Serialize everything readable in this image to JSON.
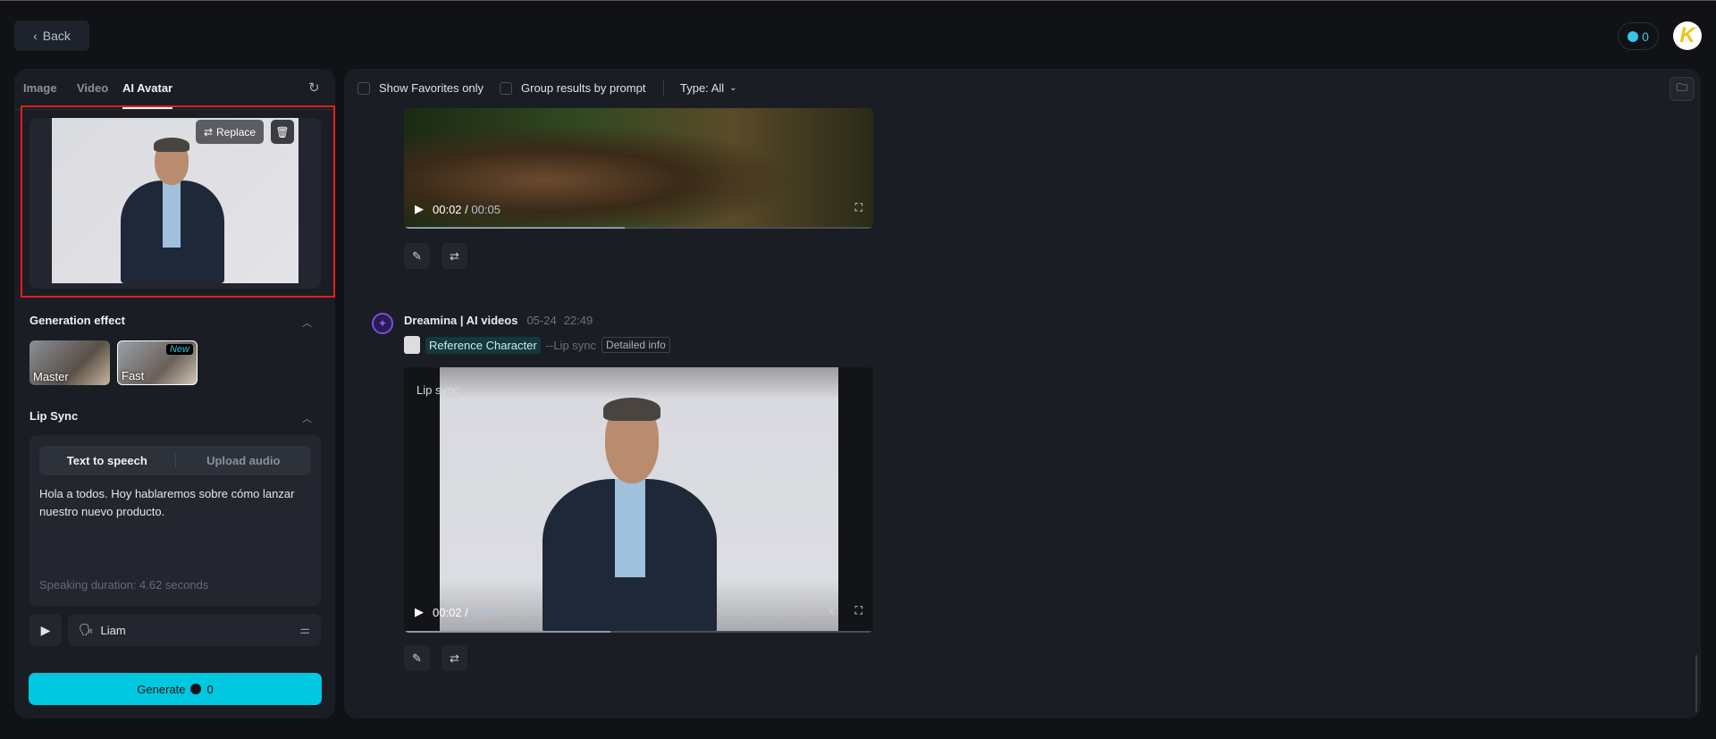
{
  "header": {
    "back_label": "Back",
    "credits": "0",
    "user_initial": "K"
  },
  "left_panel": {
    "tabs": [
      {
        "label": "Image"
      },
      {
        "label": "Video"
      },
      {
        "label": "AI Avatar",
        "active": true
      }
    ],
    "image_card": {
      "replace_label": "Replace"
    },
    "generation_effect": {
      "title": "Generation effect",
      "options": [
        {
          "label": "Master"
        },
        {
          "label": "Fast",
          "badge": "New",
          "selected": true
        }
      ]
    },
    "lip_sync": {
      "title": "Lip Sync",
      "modes": [
        {
          "label": "Text to speech",
          "active": true
        },
        {
          "label": "Upload audio"
        }
      ],
      "text": "Hola a todos. Hoy hablaremos sobre cómo lanzar nuestro nuevo producto.",
      "duration": "Speaking duration: 4.62 seconds",
      "voice": "Liam"
    },
    "generate": {
      "label": "Generate",
      "cost": "0"
    }
  },
  "toolbar": {
    "favorites_label": "Show Favorites only",
    "group_label": "Group results by prompt",
    "type_label": "Type: All"
  },
  "results": [
    {
      "current_time": "00:02",
      "total_time": "00:05",
      "progress": 0.47
    },
    {
      "author": "Dreamina | AI videos",
      "date": "05-24",
      "time": "22:49",
      "reference": "Reference Character",
      "mode": "--Lip sync",
      "details_label": "Detailed info",
      "overlay": "Lip sync",
      "current_time": "00:02",
      "total_time": "00:05",
      "progress": 0.44
    }
  ],
  "colors": {
    "accent": "#00c8e0",
    "highlight": "#e0201f",
    "brand": "#7a4fe0"
  }
}
